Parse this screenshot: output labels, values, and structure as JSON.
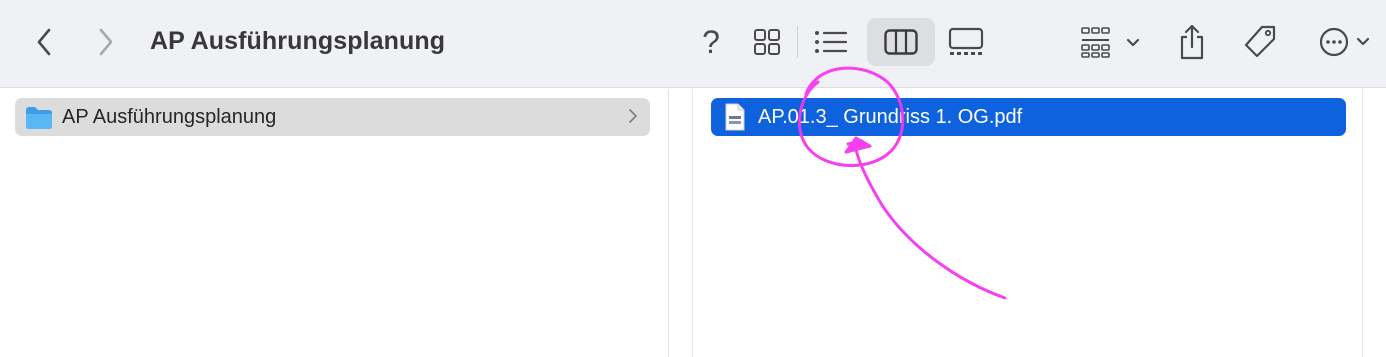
{
  "window": {
    "title": "AP Ausführungsplanung"
  },
  "toolbar": {
    "back_icon": "chevron-left-icon",
    "forward_icon": "chevron-right-icon",
    "help_glyph": "?",
    "view_icons": [
      "grid-view-icon",
      "list-view-icon",
      "column-view-icon",
      "gallery-view-icon"
    ],
    "active_view": "column-view-icon",
    "group_icon": "group-by-icon",
    "share_icon": "share-icon",
    "tag_icon": "tag-icon",
    "more_icon": "more-icon"
  },
  "columns": [
    {
      "items": [
        {
          "label": "AP Ausführungsplanung",
          "kind": "folder",
          "selected": "inactive"
        }
      ]
    },
    {
      "items": [
        {
          "label": "AP.01.3_ Grundriss 1. OG.pdf",
          "kind": "pdf",
          "selected": "active"
        }
      ]
    }
  ],
  "annotation": {
    "color": "#f536f0",
    "kind": "hand-drawn circle with arrow"
  }
}
